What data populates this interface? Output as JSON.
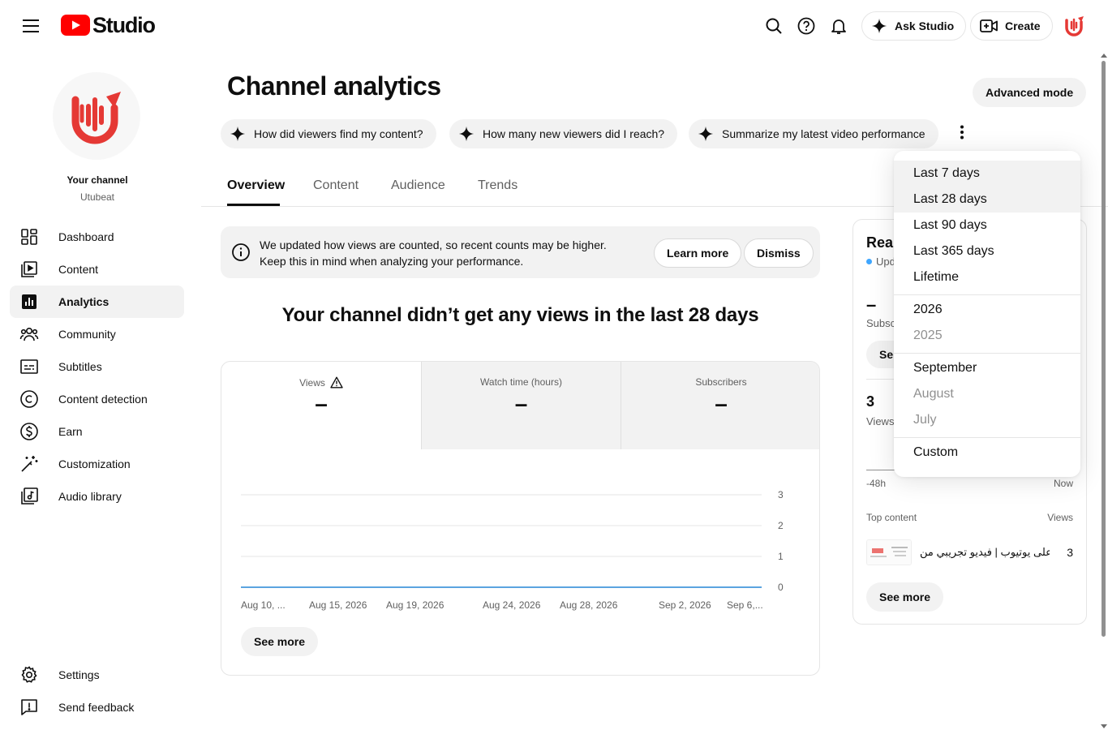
{
  "header": {
    "logo_text": "Studio",
    "ask_studio_label": "Ask Studio",
    "create_label": "Create"
  },
  "sidebar": {
    "channel_title": "Your channel",
    "channel_name": "Utubeat",
    "items": [
      {
        "label": "Dashboard",
        "icon": "dashboard-icon"
      },
      {
        "label": "Content",
        "icon": "content-icon"
      },
      {
        "label": "Analytics",
        "icon": "analytics-icon",
        "active": true
      },
      {
        "label": "Community",
        "icon": "community-icon"
      },
      {
        "label": "Subtitles",
        "icon": "subtitles-icon"
      },
      {
        "label": "Content detection",
        "icon": "copyright-icon"
      },
      {
        "label": "Earn",
        "icon": "dollar-icon"
      },
      {
        "label": "Customization",
        "icon": "magic-wand-icon"
      },
      {
        "label": "Audio library",
        "icon": "audio-library-icon"
      }
    ],
    "settings_label": "Settings",
    "feedback_label": "Send feedback"
  },
  "main": {
    "title": "Channel analytics",
    "advanced_mode_label": "Advanced mode",
    "chips": [
      "How did viewers find my content?",
      "How many new viewers did I reach?",
      "Summarize my latest video performance"
    ],
    "tabs": [
      "Overview",
      "Content",
      "Audience",
      "Trends"
    ],
    "active_tab": "Overview",
    "notice": {
      "line1": "We updated how views are counted, so recent counts may be higher.",
      "line2": "Keep this in mind when analyzing your performance.",
      "learn_more": "Learn more",
      "dismiss": "Dismiss"
    },
    "headline": "Your channel didn’t get any views in the last 28 days",
    "metrics": [
      {
        "label": "Views",
        "value": "–",
        "warning": true
      },
      {
        "label": "Watch time (hours)",
        "value": "–"
      },
      {
        "label": "Subscribers",
        "value": "–"
      }
    ],
    "see_more": "See more"
  },
  "chart_data": {
    "type": "line",
    "x_tick_labels": [
      "Aug 10, ...",
      "Aug 15, 2026",
      "Aug 19, 2026",
      "Aug 24, 2026",
      "Aug 28, 2026",
      "Sep 2, 2026",
      "Sep 6,..."
    ],
    "y_ticks": [
      0,
      1,
      2,
      3
    ],
    "ylim": [
      0,
      3
    ],
    "series": [
      {
        "values": [
          0,
          0,
          0,
          0,
          0,
          0,
          0
        ]
      }
    ],
    "grid": true,
    "line_color": "#5ba4e0"
  },
  "realtime": {
    "title": "Real",
    "updating": "Upd",
    "subs_value": "–",
    "subs_label": "Subsc",
    "subs_btn": "Se",
    "views_value": "3",
    "views_label": "Views",
    "axis_left": "-48h",
    "axis_right": "Now",
    "top_content_label": "Top content",
    "views_header": "Views",
    "video_title": "على يوتيوب | فيديو تجريبي من ...",
    "video_views": "3",
    "see_more": "See more"
  },
  "dropdown": {
    "groups": [
      [
        {
          "label": "Last 7 days",
          "highlighted": true
        },
        {
          "label": "Last 28 days",
          "highlighted": true
        },
        {
          "label": "Last 90 days"
        },
        {
          "label": "Last 365 days"
        },
        {
          "label": "Lifetime"
        }
      ],
      [
        {
          "label": "2026"
        },
        {
          "label": "2025",
          "disabled": true
        }
      ],
      [
        {
          "label": "September"
        },
        {
          "label": "August",
          "disabled": true
        },
        {
          "label": "July",
          "disabled": true
        }
      ],
      [
        {
          "label": "Custom"
        }
      ]
    ]
  },
  "colors": {
    "brand_red": "#ff0000",
    "channel_red": "#e53935",
    "accent_blue": "#3ea6ff"
  }
}
